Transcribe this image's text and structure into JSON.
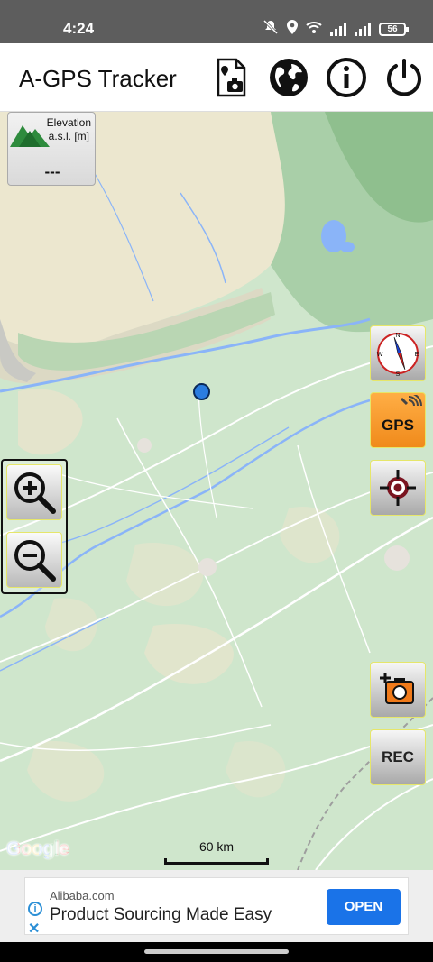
{
  "status_bar": {
    "time": "4:24",
    "battery": "56",
    "icons": [
      "mute-icon",
      "location-icon",
      "wifi-icon",
      "signal-icon",
      "signal-icon",
      "battery-icon"
    ]
  },
  "app_bar": {
    "title": "A-GPS Tracker",
    "icons": [
      "photo-file-icon",
      "globe-icon",
      "info-icon",
      "power-icon"
    ]
  },
  "map": {
    "elevation": {
      "label_line1": "Elevation",
      "label_line2": "a.s.l. [m]",
      "value": "---"
    },
    "gps_label": "GPS",
    "rec_label": "REC",
    "scale_label": "60 km",
    "attribution": "Google",
    "colors": {
      "land": "#cfe6cc",
      "highland": "#e8e4cc",
      "river": "#8ab4f8",
      "location_dot": "#2b7de0",
      "gps_button": "#f39a2c"
    }
  },
  "ad": {
    "source": "Alibaba.com",
    "headline": "Product Sourcing Made Easy",
    "cta": "OPEN"
  }
}
